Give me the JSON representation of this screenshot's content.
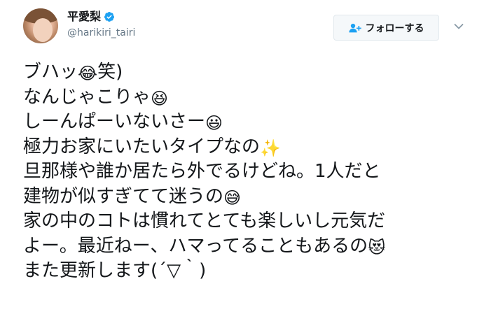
{
  "user": {
    "display_name": "平愛梨",
    "handle": "@harikiri_tairi"
  },
  "follow_button": {
    "label": "フォローする"
  },
  "tweet": {
    "lines": [
      {
        "text": "ブハッ",
        "emoji": "😂",
        "after": "笑)"
      },
      {
        "text": "なんじゃこりゃ",
        "emoji": "😆",
        "after": ""
      },
      {
        "text": "しーんぱーいないさー",
        "emoji": "😃",
        "after": ""
      },
      {
        "text": "極力お家にいたいタイプなの",
        "emoji": "✨",
        "after": ""
      },
      {
        "text": "旦那様や誰か居たら外でるけどね。1人だと",
        "emoji": "",
        "after": ""
      },
      {
        "text": "建物が似すぎてて迷うの",
        "emoji": "😅",
        "after": ""
      },
      {
        "text": "家の中のコトは慣れてとても楽しいし元気だ",
        "emoji": "",
        "after": ""
      },
      {
        "text": "よー。最近ねー、ハマってることもあるの",
        "emoji": "😻",
        "after": ""
      },
      {
        "text": "また更新します(´▽｀)",
        "emoji": "",
        "after": ""
      }
    ]
  },
  "colors": {
    "text": "#14171a",
    "secondary": "#657786",
    "verified": "#1da1f2",
    "button_bg": "#f5f8fa",
    "button_border": "#e1e8ed"
  },
  "icons": {
    "verified": "verified-badge-icon",
    "follow": "add-user-icon",
    "menu": "chevron-down-icon"
  }
}
